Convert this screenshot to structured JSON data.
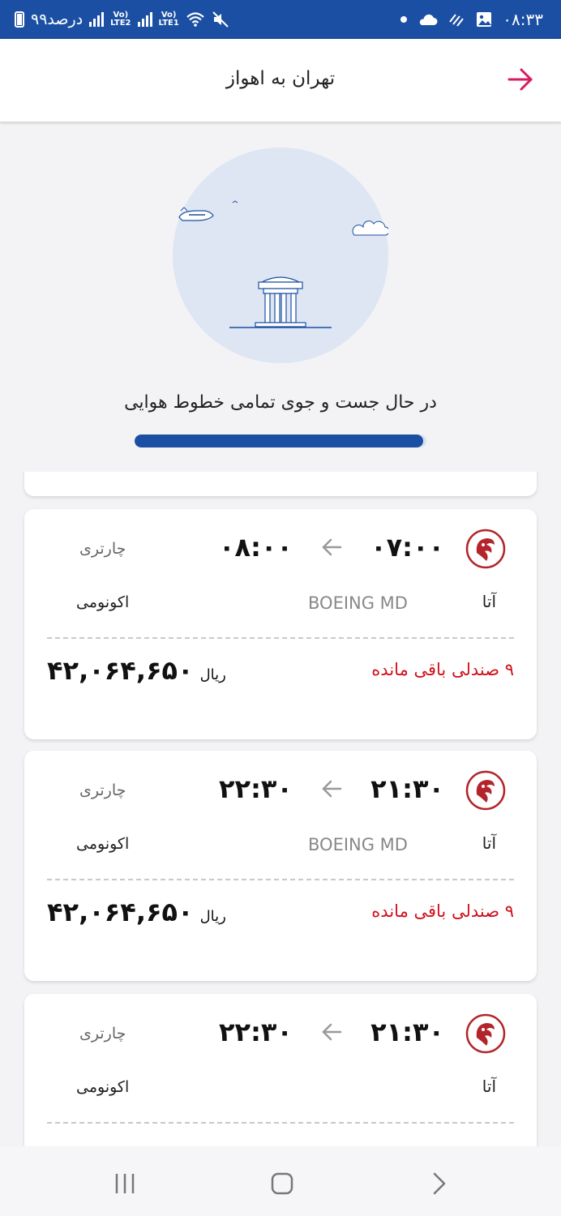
{
  "status_bar": {
    "time": "۰۸:۳۳",
    "battery": "۹۹درصد",
    "net1": "LTE2",
    "net2": "LTE1"
  },
  "header": {
    "title": "تهران به اهواز"
  },
  "loading": {
    "message": "در حال جست و جوی تمامی خطوط هوایی",
    "progress": 0.99
  },
  "flights": [
    {
      "airline": "آتا",
      "depart": "۰۷:۰۰",
      "arrive": "۰۸:۰۰",
      "type": "چارتری",
      "aircraft": "BOEING MD",
      "cabin": "اکونومی",
      "seats": "۹ صندلی باقی مانده",
      "price": "۴۲,۰۶۴,۶۵۰",
      "currency": "ریال"
    },
    {
      "airline": "آتا",
      "depart": "۲۱:۳۰",
      "arrive": "۲۲:۳۰",
      "type": "چارتری",
      "aircraft": "BOEING MD",
      "cabin": "اکونومی",
      "seats": "۹ صندلی باقی مانده",
      "price": "۴۲,۰۶۴,۶۵۰",
      "currency": "ریال"
    },
    {
      "airline": "آتا",
      "depart": "۲۱:۳۰",
      "arrive": "۲۲:۳۰",
      "type": "چارتری",
      "aircraft": "",
      "cabin": "اکونومی",
      "seats": "",
      "price": "",
      "currency": ""
    }
  ],
  "colors": {
    "brand": "#1b4fa3",
    "accent": "#d81b60",
    "seats_warning": "#d0131d",
    "airline_logo": "#b3252a"
  },
  "icons": {
    "back": "arrow-right-icon",
    "route": "arrow-left-icon",
    "airline": "ata-logo-icon"
  }
}
